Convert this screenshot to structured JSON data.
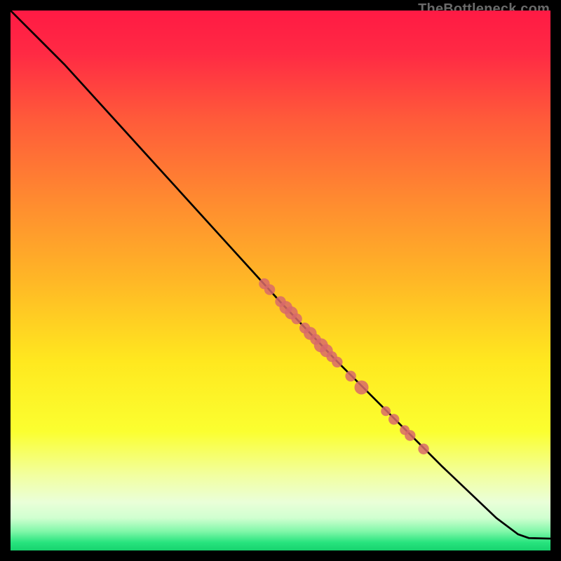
{
  "watermark": "TheBottleneck.com",
  "chart_data": {
    "type": "line",
    "title": "",
    "xlabel": "",
    "ylabel": "",
    "xlim": [
      0,
      100
    ],
    "ylim": [
      0,
      100
    ],
    "grid": false,
    "background_gradient": [
      {
        "offset": 0.0,
        "color": "#ff1a44"
      },
      {
        "offset": 0.08,
        "color": "#ff2a44"
      },
      {
        "offset": 0.2,
        "color": "#ff5a3a"
      },
      {
        "offset": 0.35,
        "color": "#ff8a30"
      },
      {
        "offset": 0.5,
        "color": "#ffb726"
      },
      {
        "offset": 0.65,
        "color": "#ffe81f"
      },
      {
        "offset": 0.78,
        "color": "#fbff30"
      },
      {
        "offset": 0.86,
        "color": "#f2ff9f"
      },
      {
        "offset": 0.91,
        "color": "#eaffd8"
      },
      {
        "offset": 0.94,
        "color": "#d0ffd0"
      },
      {
        "offset": 0.965,
        "color": "#7ff7a8"
      },
      {
        "offset": 0.985,
        "color": "#28e47e"
      },
      {
        "offset": 1.0,
        "color": "#17d36e"
      }
    ],
    "curve": [
      {
        "x": 0,
        "y": 100
      },
      {
        "x": 2,
        "y": 98
      },
      {
        "x": 5,
        "y": 95
      },
      {
        "x": 10,
        "y": 90
      },
      {
        "x": 15,
        "y": 84.5
      },
      {
        "x": 20,
        "y": 79
      },
      {
        "x": 30,
        "y": 68
      },
      {
        "x": 40,
        "y": 57
      },
      {
        "x": 50,
        "y": 46
      },
      {
        "x": 60,
        "y": 35.5
      },
      {
        "x": 70,
        "y": 25.5
      },
      {
        "x": 80,
        "y": 15.5
      },
      {
        "x": 90,
        "y": 6
      },
      {
        "x": 94,
        "y": 3
      },
      {
        "x": 96,
        "y": 2.3
      },
      {
        "x": 100,
        "y": 2.2
      }
    ],
    "scatter": [
      {
        "x": 47,
        "y": 49.4,
        "r": 1.0
      },
      {
        "x": 48,
        "y": 48.3,
        "r": 1.0
      },
      {
        "x": 50,
        "y": 46.1,
        "r": 1.0
      },
      {
        "x": 51,
        "y": 45.0,
        "r": 1.2
      },
      {
        "x": 52,
        "y": 44.0,
        "r": 1.2
      },
      {
        "x": 53,
        "y": 42.9,
        "r": 1.0
      },
      {
        "x": 54.5,
        "y": 41.2,
        "r": 1.0
      },
      {
        "x": 55.5,
        "y": 40.2,
        "r": 1.2
      },
      {
        "x": 56.5,
        "y": 39.1,
        "r": 1.0
      },
      {
        "x": 57.5,
        "y": 38.0,
        "r": 1.3
      },
      {
        "x": 58.5,
        "y": 37.0,
        "r": 1.2
      },
      {
        "x": 59.5,
        "y": 35.9,
        "r": 1.0
      },
      {
        "x": 60.5,
        "y": 34.9,
        "r": 1.0
      },
      {
        "x": 63,
        "y": 32.3,
        "r": 1.0
      },
      {
        "x": 65,
        "y": 30.2,
        "r": 1.3
      },
      {
        "x": 69.5,
        "y": 25.8,
        "r": 0.9
      },
      {
        "x": 71,
        "y": 24.3,
        "r": 1.0
      },
      {
        "x": 73,
        "y": 22.3,
        "r": 0.9
      },
      {
        "x": 74,
        "y": 21.3,
        "r": 1.0
      },
      {
        "x": 76.5,
        "y": 18.8,
        "r": 1.0
      }
    ],
    "colors": {
      "line": "#000000",
      "scatter": "#d86a6a"
    }
  }
}
